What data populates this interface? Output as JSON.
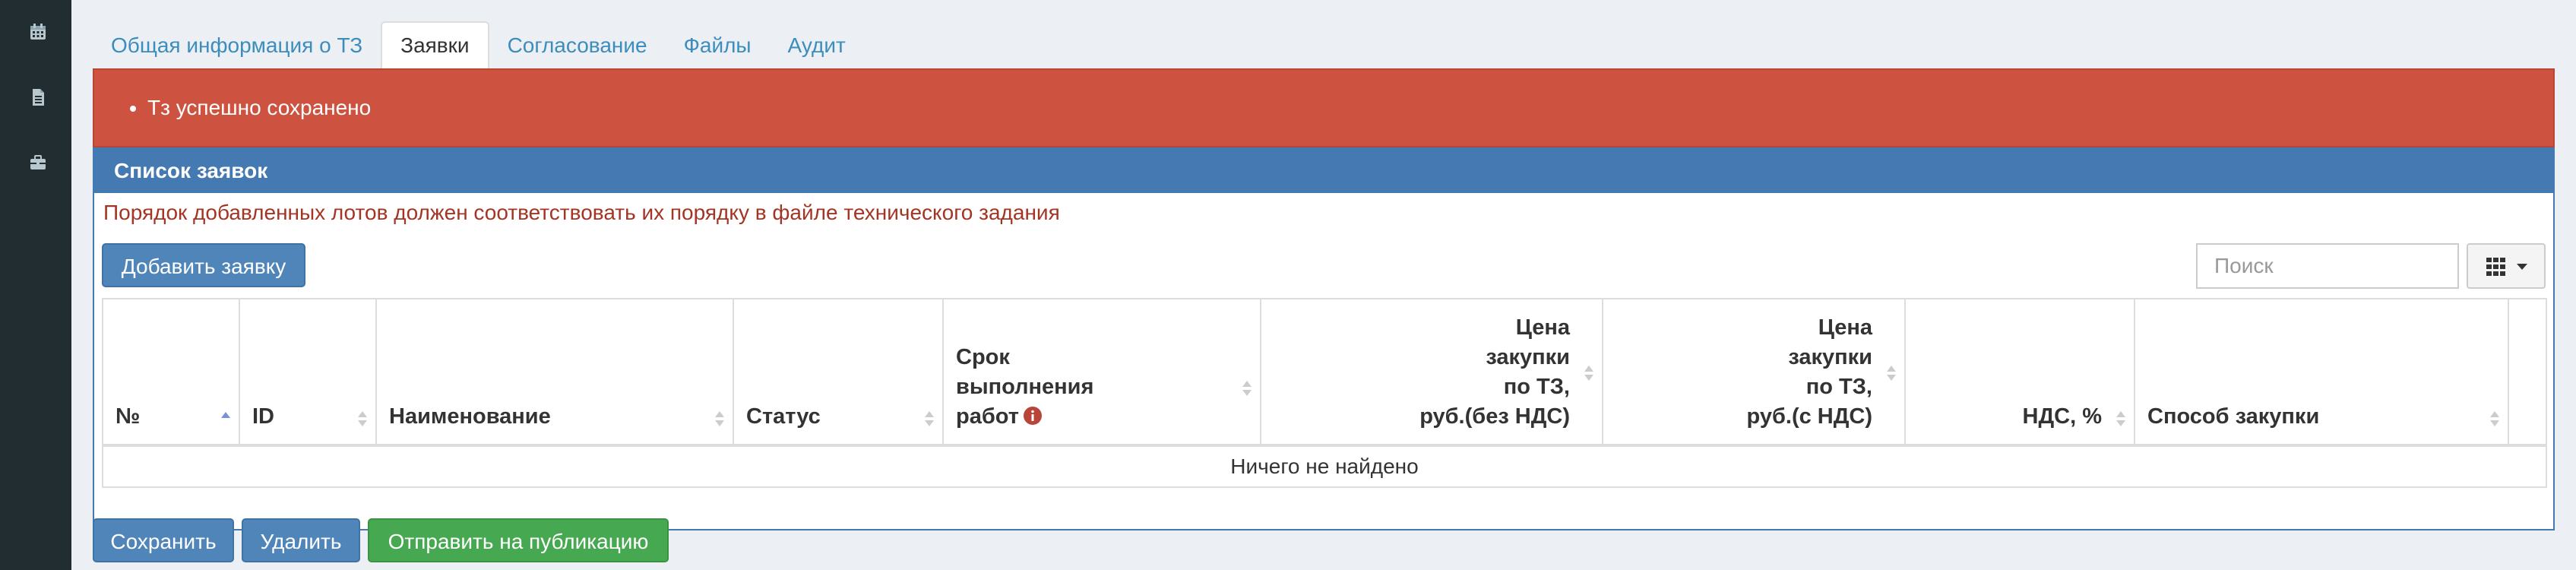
{
  "sidebar": {
    "icons": [
      "calendar-icon",
      "document-icon",
      "briefcase-icon"
    ]
  },
  "tabs": [
    {
      "label": "Общая информация о ТЗ",
      "active": false
    },
    {
      "label": "Заявки",
      "active": true
    },
    {
      "label": "Согласование",
      "active": false
    },
    {
      "label": "Файлы",
      "active": false
    },
    {
      "label": "Аудит",
      "active": false
    }
  ],
  "alert": {
    "message": "Тз успешно сохранено",
    "color": "#cd5340"
  },
  "panel": {
    "title": "Список заявок",
    "notice": "Порядок добавленных лотов должен соответствовать их порядку в файле технического задания",
    "add_button": "Добавить заявку",
    "search_placeholder": "Поиск",
    "columns_icon": "grid-icon"
  },
  "table": {
    "columns": [
      {
        "lines": [
          "№"
        ],
        "align": "left",
        "sort": "asc"
      },
      {
        "lines": [
          "ID"
        ],
        "align": "left",
        "sort": "none"
      },
      {
        "lines": [
          "Наименование"
        ],
        "align": "left",
        "sort": "none"
      },
      {
        "lines": [
          "Статус"
        ],
        "align": "left",
        "sort": "none"
      },
      {
        "lines": [
          "Срок",
          "выполнения",
          "работ"
        ],
        "align": "left",
        "sort": "none",
        "info_icon": true
      },
      {
        "lines": [
          "Цена",
          "закупки",
          "по ТЗ,",
          "руб.(без НДС)"
        ],
        "align": "right",
        "sort": "none"
      },
      {
        "lines": [
          "Цена",
          "закупки",
          "по ТЗ,",
          "руб.(с НДС)"
        ],
        "align": "right",
        "sort": "none"
      },
      {
        "lines": [
          "НДС, %"
        ],
        "align": "right",
        "sort": "none"
      },
      {
        "lines": [
          "Способ закупки"
        ],
        "align": "left",
        "sort": "none"
      }
    ],
    "empty_message": "Ничего не найдено"
  },
  "actions": {
    "save": "Сохранить",
    "delete": "Удалить",
    "publish": "Отправить на публикацию"
  },
  "colors": {
    "sidebar": "#222d32",
    "panel_header": "#4579b2",
    "primary_button": "#4f85b8",
    "success_button": "#46a850",
    "notice_text": "#a33524",
    "tab_link": "#3c8dbc"
  }
}
